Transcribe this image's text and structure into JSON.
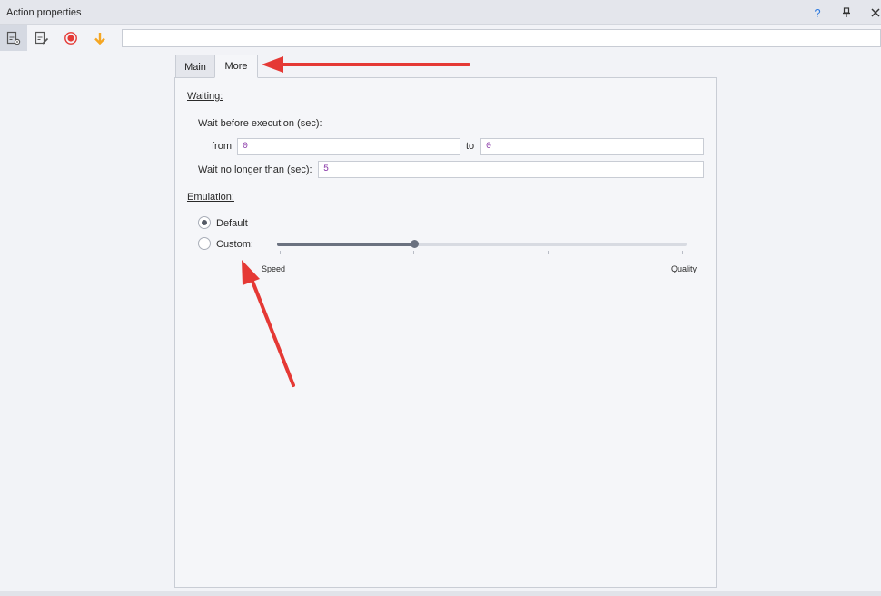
{
  "window": {
    "title": "Action properties",
    "help_label": "?"
  },
  "toolbar": {
    "icons": [
      "properties-settings-icon",
      "edit-notes-icon",
      "record-icon",
      "arrow-down-icon"
    ],
    "name_value": ""
  },
  "tabs": [
    {
      "label": "Main",
      "active": false
    },
    {
      "label": "More",
      "active": true
    }
  ],
  "waiting": {
    "section_label": "Waiting:",
    "wait_before_label": "Wait before execution (sec):",
    "from_label": "from",
    "from_value": "0",
    "to_label": "to",
    "to_value": "0",
    "wait_no_longer_label": "Wait no longer than (sec):",
    "wait_no_longer_value": "5"
  },
  "emulation": {
    "section_label": "Emulation:",
    "options": [
      {
        "label": "Default",
        "checked": true
      },
      {
        "label": "Custom:",
        "checked": false
      }
    ],
    "slider": {
      "value_fraction": 0.335,
      "min_label": "Speed",
      "max_label": "Quality"
    }
  },
  "colors": {
    "accent_blue": "#2f7be0",
    "record_red": "#e53935",
    "arrow_orange": "#f5a623",
    "annotation_red": "#e53935",
    "value_purple": "#8a3aa8"
  }
}
